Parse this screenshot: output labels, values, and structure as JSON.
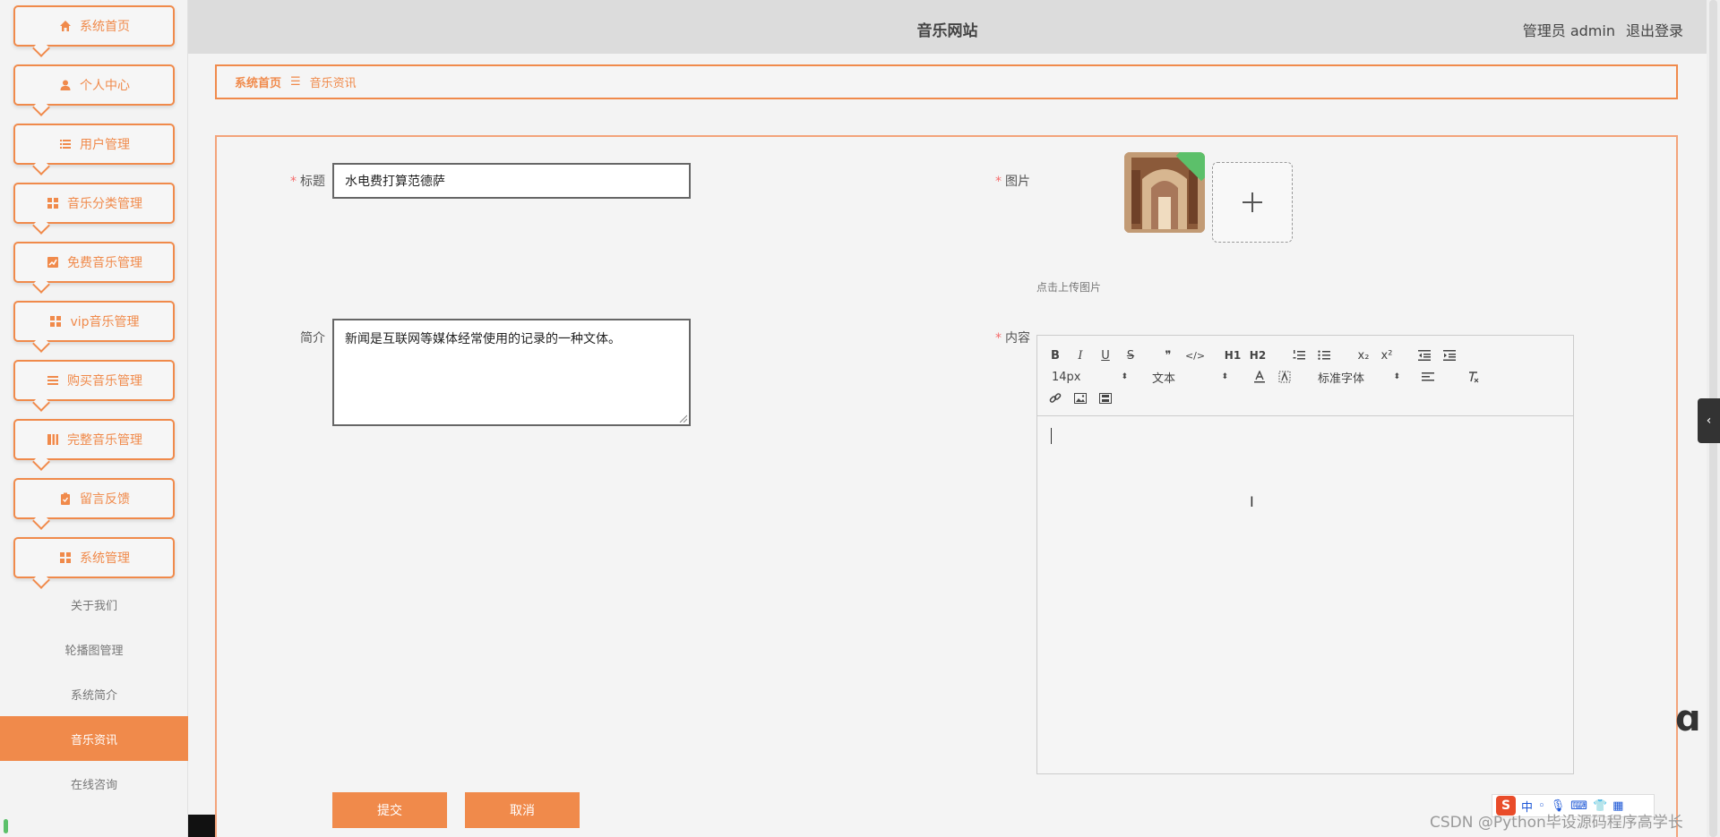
{
  "header": {
    "site_title": "音乐网站",
    "user_label": "管理员 admin",
    "logout": "退出登录"
  },
  "sidebar": {
    "items": [
      {
        "label": "系统首页",
        "icon": "home-icon"
      },
      {
        "label": "个人中心",
        "icon": "user-icon"
      },
      {
        "label": "用户管理",
        "icon": "list-icon"
      },
      {
        "label": "音乐分类管理",
        "icon": "grid-icon"
      },
      {
        "label": "免费音乐管理",
        "icon": "chart-icon"
      },
      {
        "label": "vip音乐管理",
        "icon": "grid-icon"
      },
      {
        "label": "购买音乐管理",
        "icon": "list-icon"
      },
      {
        "label": "完整音乐管理",
        "icon": "book-icon"
      },
      {
        "label": "留言反馈",
        "icon": "clipboard-icon"
      },
      {
        "label": "系统管理",
        "icon": "grid-icon"
      }
    ],
    "submenu": [
      "关于我们",
      "轮播图管理",
      "系统简介",
      "音乐资讯",
      "在线咨询"
    ],
    "active_submenu": "音乐资讯"
  },
  "breadcrumb": {
    "home": "系统首页",
    "separator": "☰",
    "current": "音乐资讯"
  },
  "form": {
    "title_label": "标题",
    "title_value": "水电费打算范德萨",
    "image_label": "图片",
    "upload_tip": "点击上传图片",
    "intro_label": "简介",
    "intro_value": "新闻是互联网等媒体经常使用的记录的一种文体。",
    "content_label": "内容",
    "required_mark": "*",
    "submit": "提交",
    "cancel": "取消"
  },
  "editor": {
    "font_size": "14px",
    "paragraph": "文本",
    "font_family": "标准字体",
    "buttons": [
      "B",
      "I",
      "U",
      "S",
      "❞",
      "</>",
      "H1",
      "H2",
      "ordered-list",
      "bullet-list",
      "x₂",
      "x²",
      "outdent",
      "indent"
    ]
  },
  "ime": {
    "logo": "S",
    "mode": "中"
  },
  "watermark": "CSDN @Python毕设源码程序高学长",
  "colors": {
    "accent": "#f08a4b",
    "required": "#f56c6c"
  }
}
